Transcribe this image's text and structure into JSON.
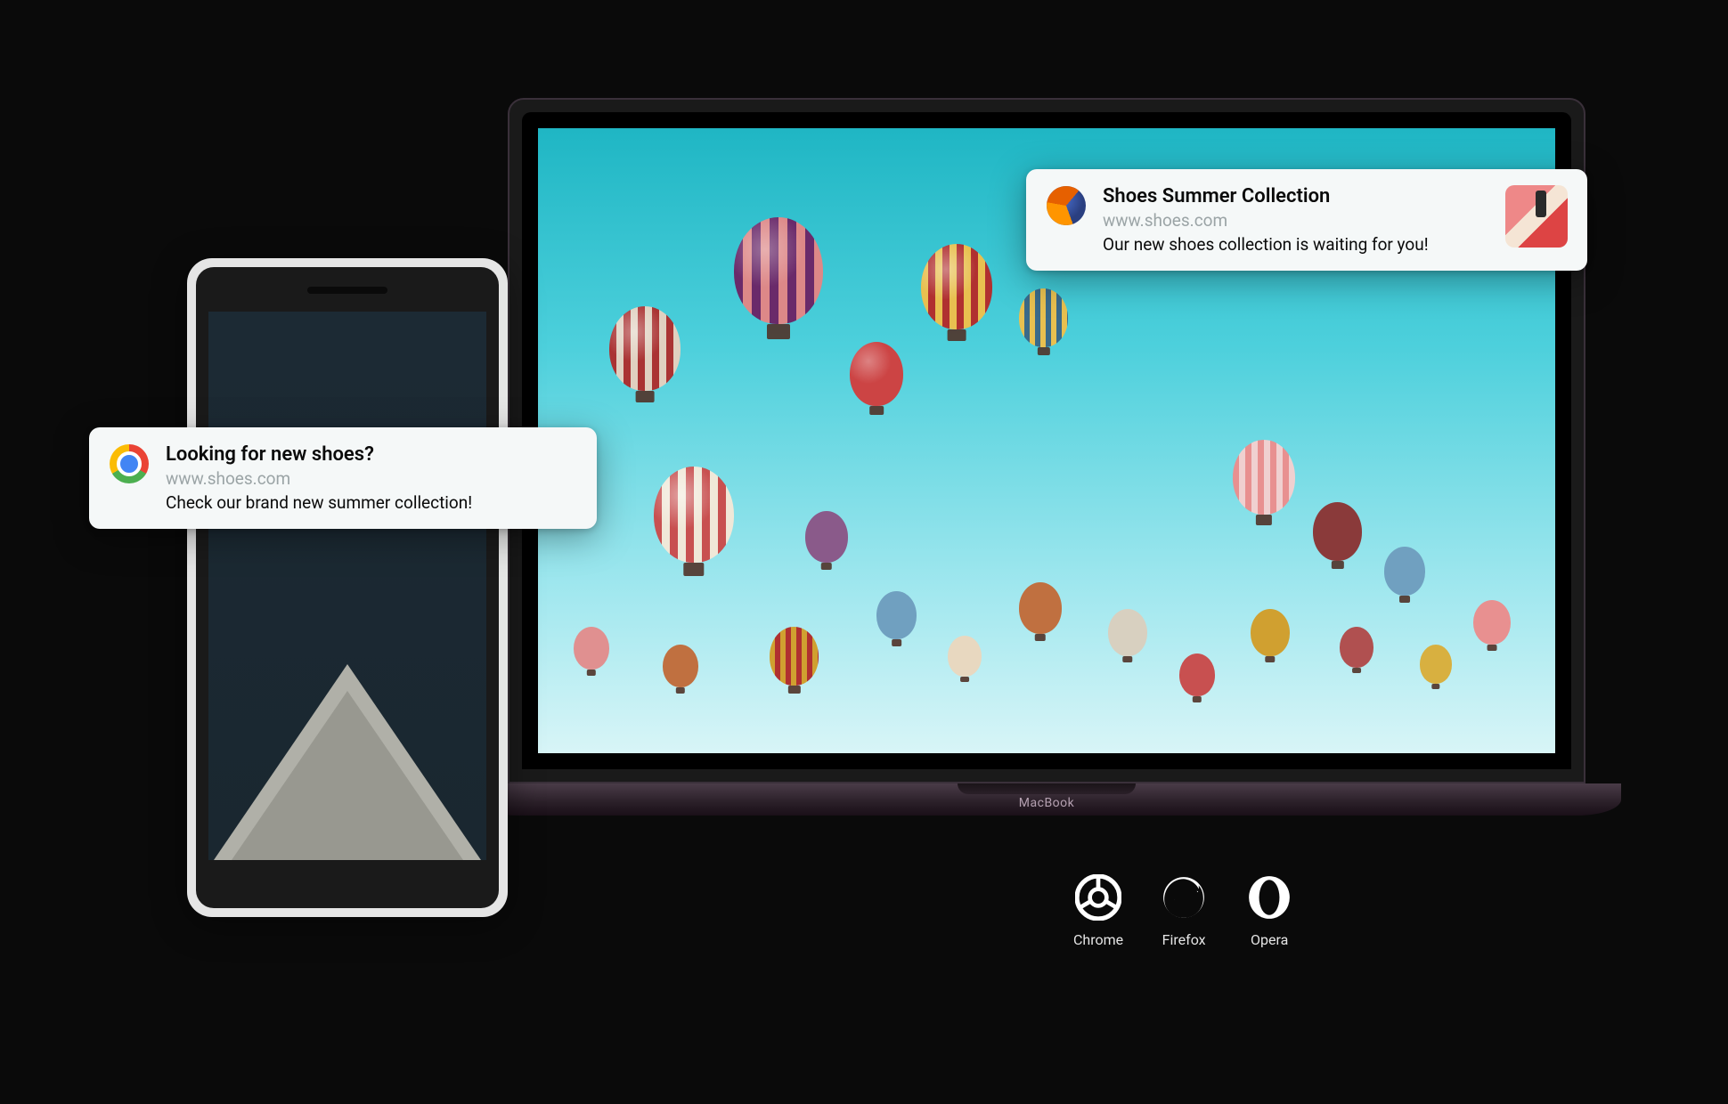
{
  "notifications": {
    "left": {
      "browser": "chrome",
      "title": "Looking for new shoes?",
      "domain": "www.shoes.com",
      "message": "Check our brand new summer collection!"
    },
    "right": {
      "browser": "firefox",
      "title": "Shoes Summer Collection",
      "domain": "www.shoes.com",
      "message": "Our new shoes collection is waiting for you!"
    }
  },
  "laptop": {
    "brand": "MacBook"
  },
  "browsers": [
    {
      "name": "Chrome"
    },
    {
      "name": "Firefox"
    },
    {
      "name": "Opera"
    }
  ]
}
